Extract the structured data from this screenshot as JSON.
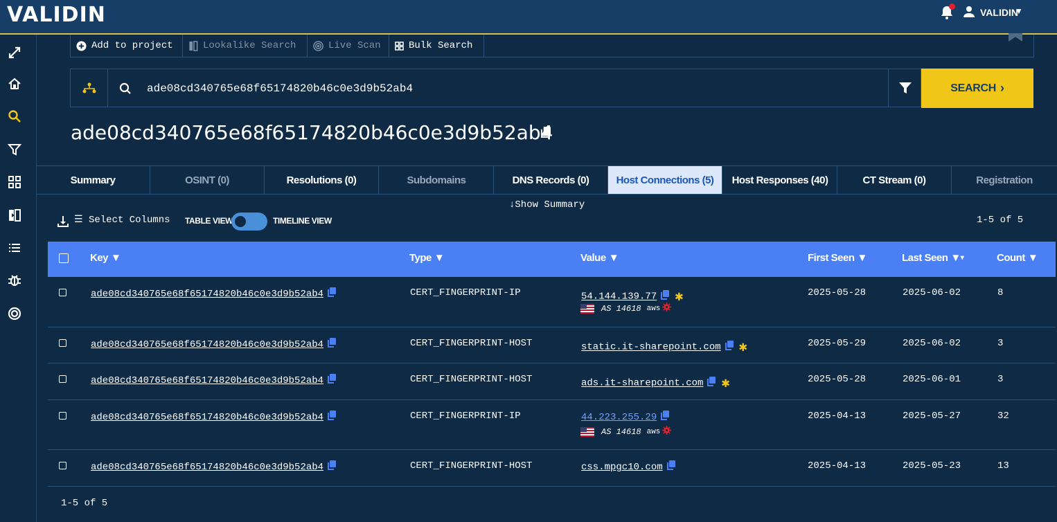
{
  "brand": {
    "logo": "VALIDIN"
  },
  "user": {
    "name": "VALIDIN"
  },
  "actions": [
    {
      "label": "Add to project",
      "enabled": true
    },
    {
      "label": "Lookalike Search",
      "enabled": false
    },
    {
      "label": "Live Scan",
      "enabled": false
    },
    {
      "label": "Bulk Search",
      "enabled": true
    }
  ],
  "search": {
    "value": "ade08cd340765e68f65174820b46c0e3d9b52ab4",
    "button_label": "SEARCH"
  },
  "page": {
    "title": "ade08cd340765e68f65174820b46c0e3d9b52ab4"
  },
  "tabs": [
    {
      "label": "Summary",
      "state": "normal"
    },
    {
      "label": "OSINT (0)",
      "state": "dim"
    },
    {
      "label": "Resolutions (0)",
      "state": "normal"
    },
    {
      "label": "Subdomains",
      "state": "dim"
    },
    {
      "label": "DNS Records (0)",
      "state": "normal"
    },
    {
      "label": "Host Connections (5)",
      "state": "active"
    },
    {
      "label": "Host Responses (40)",
      "state": "normal"
    },
    {
      "label": "CT Stream (0)",
      "state": "normal"
    },
    {
      "label": "Registration",
      "state": "dim"
    }
  ],
  "toolbar": {
    "show_summary": "Show Summary",
    "select_columns": "Select Columns",
    "table_view": "TABLE VIEW",
    "timeline_view": "TIMELINE VIEW",
    "pagination": "1-5 of 5"
  },
  "table": {
    "columns": [
      "Key",
      "Type",
      "Value",
      "First Seen",
      "Last Seen",
      "Count"
    ],
    "rows": [
      {
        "key": "ade08cd340765e68f65174820b46c0e3d9b52ab4",
        "type": "CERT_FINGERPRINT-IP",
        "value": "54.144.139.77",
        "first_seen": "2025-05-28",
        "last_seen": "2025-06-02",
        "count": "8",
        "asn": "AS 14618",
        "provider": "aws",
        "starred": true
      },
      {
        "key": "ade08cd340765e68f65174820b46c0e3d9b52ab4",
        "type": "CERT_FINGERPRINT-HOST",
        "value": "static.it-sharepoint.com",
        "first_seen": "2025-05-29",
        "last_seen": "2025-06-02",
        "count": "3",
        "starred": true
      },
      {
        "key": "ade08cd340765e68f65174820b46c0e3d9b52ab4",
        "type": "CERT_FINGERPRINT-HOST",
        "value": "ads.it-sharepoint.com",
        "first_seen": "2025-05-28",
        "last_seen": "2025-06-01",
        "count": "3",
        "starred": true
      },
      {
        "key": "ade08cd340765e68f65174820b46c0e3d9b52ab4",
        "type": "CERT_FINGERPRINT-IP",
        "value": "44.223.255.29",
        "first_seen": "2025-04-13",
        "last_seen": "2025-05-27",
        "count": "32",
        "asn": "AS 14618",
        "provider": "aws",
        "starred": false
      },
      {
        "key": "ade08cd340765e68f65174820b46c0e3d9b52ab4",
        "type": "CERT_FINGERPRINT-HOST",
        "value": "css.mpgc10.com",
        "first_seen": "2025-04-13",
        "last_seen": "2025-05-23",
        "count": "13",
        "starred": false
      }
    ]
  },
  "colors": {
    "background": "#0f2a45",
    "topbar": "#173e66",
    "accent": "#f0c619",
    "table_header": "#4b80f5",
    "active_tab_bg": "#dde9fb"
  }
}
